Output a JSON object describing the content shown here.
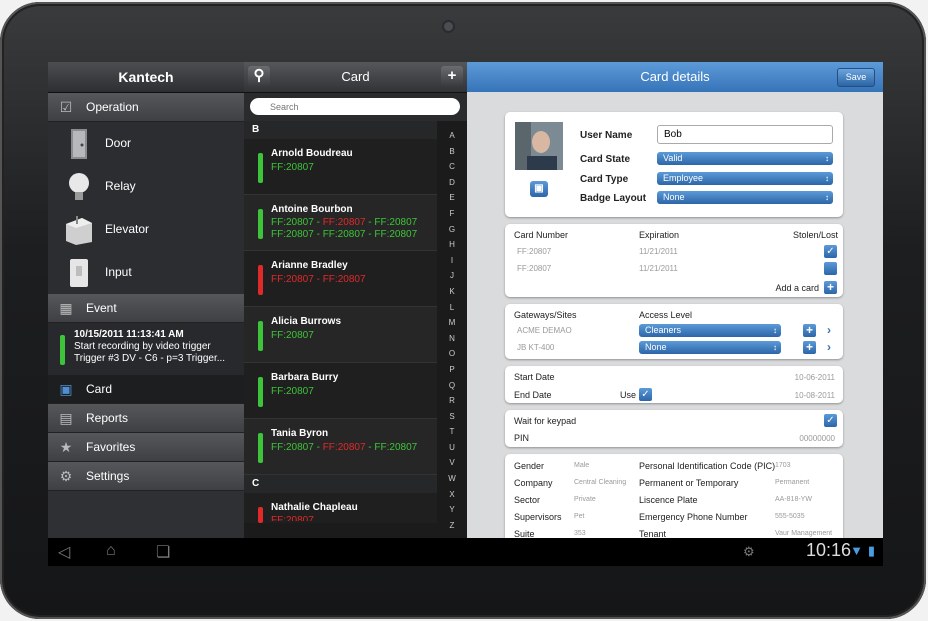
{
  "nav": {
    "title": "Kantech",
    "operation": "Operation",
    "subitems": [
      {
        "label": "Door",
        "icon": "door-icon"
      },
      {
        "label": "Relay",
        "icon": "lightbulb-icon"
      },
      {
        "label": "Elevator",
        "icon": "elevator-icon"
      },
      {
        "label": "Input",
        "icon": "switch-icon"
      }
    ],
    "event": "Event",
    "event_entry": {
      "time": "10/15/2011 11:13:41 AM",
      "line1": "Start recording by video trigger",
      "line2": "Trigger #3 DV - C6 - p=3 Trigger..."
    },
    "card": "Card",
    "reports": "Reports",
    "favorites": "Favorites",
    "settings": "Settings"
  },
  "list": {
    "title": "Card",
    "search_placeholder": "Search",
    "letter_b": "B",
    "letter_c": "C",
    "entries": [
      {
        "name": "Arnold Boudreau",
        "line1": "FF:20807",
        "line2": ""
      },
      {
        "name": "Antoine Bourbon",
        "line1a": "FF:20807",
        "line1b": "FF:20807",
        "line1c": "FF:20807",
        "line2": "FF:20807 - FF:20807 - FF:20807"
      },
      {
        "name": "Arianne Bradley",
        "line1a": "FF:20807",
        "line1b": "FF:20807"
      },
      {
        "name": "Alicia Burrows",
        "line1": "FF:20807"
      },
      {
        "name": "Barbara Burry",
        "line1": "FF:20807"
      },
      {
        "name": "Tania Byron",
        "line1a": "FF:20807",
        "line1b": "FF:20807",
        "line1c": "FF:20807"
      },
      {
        "name": "Nathalie Chapleau",
        "line1": "FF:20807"
      }
    ],
    "index": [
      "A",
      "B",
      "C",
      "D",
      "E",
      "F",
      "G",
      "H",
      "I",
      "J",
      "K",
      "L",
      "M",
      "N",
      "O",
      "P",
      "Q",
      "R",
      "S",
      "T",
      "U",
      "V",
      "W",
      "X",
      "Y",
      "Z"
    ]
  },
  "details": {
    "title": "Card details",
    "save": "Save",
    "user_name_label": "User Name",
    "user_name_value": "Bob",
    "card_state_label": "Card State",
    "card_state_value": "Valid",
    "card_type_label": "Card Type",
    "card_type_value": "Employee",
    "badge_layout_label": "Badge Layout",
    "badge_layout_value": "None",
    "cards": {
      "col1": "Card Number",
      "col2": "Expiration",
      "col3": "Stolen/Lost",
      "rows": [
        {
          "number": "FF:20807",
          "expiration": "11/21/2011"
        },
        {
          "number": "FF:20807",
          "expiration": "11/21/2011"
        }
      ],
      "add": "Add a card"
    },
    "access": {
      "col1": "Gateways/Sites",
      "col2": "Access Level",
      "rows": [
        {
          "site": "ACME DEMAO",
          "level": "Cleaners"
        },
        {
          "site": "JB KT-400",
          "level": "None"
        }
      ]
    },
    "dates": {
      "start_label": "Start Date",
      "start_value": "10-06-2011",
      "end_label": "End Date",
      "use_label": "Use",
      "end_value": "10-08-2011"
    },
    "keypad": {
      "wait_label": "Wait for keypad",
      "pin_label": "PIN",
      "pin_value": "00000000"
    },
    "info": {
      "gender_label": "Gender",
      "gender_value": "Male",
      "company_label": "Company",
      "company_value": "Central Cleaning",
      "sector_label": "Sector",
      "sector_value": "Private",
      "supervisors_label": "Supervisors",
      "supervisors_value": "Pet",
      "suite_label": "Suite",
      "suite_value": "353",
      "pic_label": "Personal Identification Code (PIC)",
      "pic_value": "1703",
      "perm_label": "Permanent or Temporary",
      "perm_value": "Permanent",
      "plate_label": "Liscence Plate",
      "plate_value": "AA-818-YW",
      "phone_label": "Emergency Phone Number",
      "phone_value": "555-5035",
      "tenant_label": "Tenant",
      "tenant_value": "Vaur Management"
    }
  },
  "system": {
    "clock": "10:16"
  },
  "colors": {
    "accent_blue": "#3674b9",
    "active_green": "#3ec43a",
    "alert_red": "#e02a2a"
  }
}
